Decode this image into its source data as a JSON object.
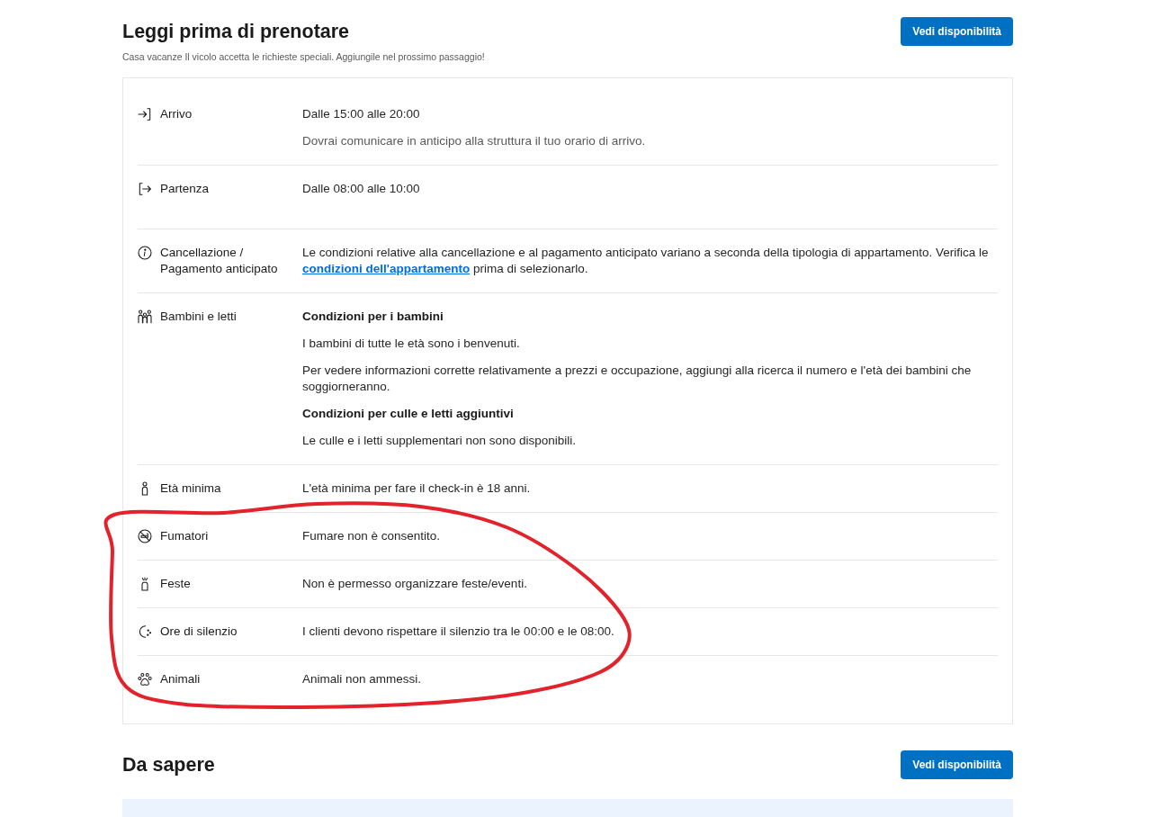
{
  "sections": [
    {
      "kind": "rules",
      "title": "Leggi prima di prenotare",
      "subtitle": "Casa vacanze Il vicolo accetta le richieste speciali. Aggiungile nel prossimo passaggio!",
      "button": "Vedi disponibilità",
      "rows": [
        {
          "kind": "schedule",
          "label": "Arrivo",
          "highlighted": false,
          "paragraphs": [
            {
              "kind": "text",
              "text": "Dalle 15:00 alle 20:00"
            },
            {
              "kind": "note",
              "text": "Dovrai comunicare in anticipo alla struttura il tuo orario di arrivo."
            }
          ]
        },
        {
          "kind": "schedule",
          "label": "Partenza",
          "highlighted": false,
          "paragraphs": [
            {
              "kind": "text",
              "text": "Dalle 08:00 alle 10:00"
            }
          ]
        },
        {
          "kind": "policy",
          "label": "Cancellazione / Pagamento anticipato",
          "highlighted": false,
          "paragraphs": [
            {
              "kind": "text",
              "text": "Le condizioni relative alla cancellazione e al pagamento anticipato variano a seconda della tipologia di appartamento. Verifica le",
              "link": "condizioni dell'appartamento",
              "text_after": "prima di selezionarlo."
            }
          ]
        },
        {
          "kind": "policy",
          "label": "Bambini e letti",
          "highlighted": false,
          "paragraphs": [
            {
              "kind": "heading",
              "text": "Condizioni per i bambini"
            },
            {
              "kind": "text",
              "text": "I bambini di tutte le età sono i benvenuti."
            },
            {
              "kind": "text",
              "text": "Per vedere informazioni corrette relativamente a prezzi e occupazione, aggiungi alla ricerca il numero e l'età dei bambini che soggiorneranno."
            },
            {
              "kind": "heading",
              "text": "Condizioni per culle e letti aggiuntivi"
            },
            {
              "kind": "text",
              "text": "Le culle e i letti supplementari non sono disponibili."
            }
          ]
        },
        {
          "kind": "policy",
          "label": "Età minima",
          "highlighted": false,
          "paragraphs": [
            {
              "kind": "text",
              "text": "L'età minima per fare il check-in è 18 anni."
            }
          ]
        },
        {
          "kind": "policy",
          "label": "Fumatori",
          "highlighted": true,
          "paragraphs": [
            {
              "kind": "text",
              "text": "Fumare non è consentito."
            }
          ]
        },
        {
          "kind": "policy",
          "label": "Feste",
          "highlighted": true,
          "paragraphs": [
            {
              "kind": "text",
              "text": "Non è permesso organizzare feste/eventi."
            }
          ]
        },
        {
          "kind": "policy",
          "label": "Ore di silenzio",
          "highlighted": true,
          "paragraphs": [
            {
              "kind": "text",
              "text": "I clienti devono rispettare il silenzio tra le 00:00 e le 08:00."
            }
          ]
        },
        {
          "kind": "policy",
          "label": "Animali",
          "highlighted": true,
          "paragraphs": [
            {
              "kind": "text",
              "text": "Animali non ammessi."
            }
          ]
        }
      ]
    },
    {
      "kind": "notice",
      "title": "Da sapere",
      "button": "Vedi disponibilità"
    }
  ]
}
